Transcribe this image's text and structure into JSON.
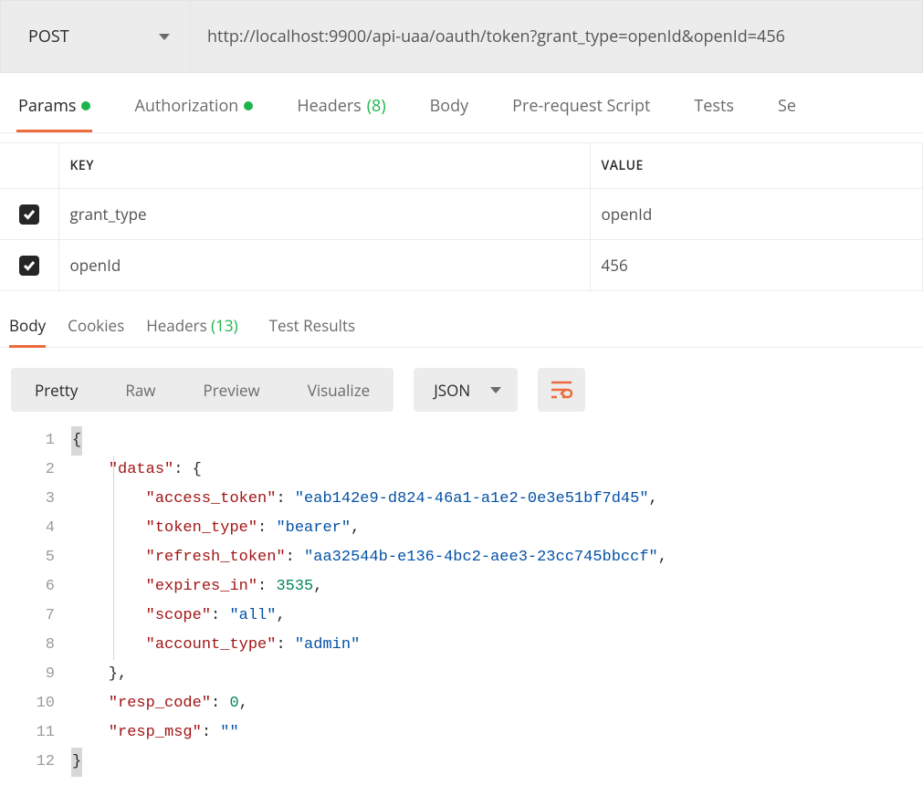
{
  "request": {
    "method": "POST",
    "url": "http://localhost:9900/api-uaa/oauth/token?grant_type=openId&openId=456"
  },
  "requestTabs": {
    "gap1": 50,
    "items": [
      {
        "label": "Params",
        "dot": true,
        "active": true
      },
      {
        "label": "Authorization",
        "dot": true
      },
      {
        "label": "Headers",
        "count": "(8)"
      },
      {
        "label": "Body"
      },
      {
        "label": "Pre-request Script"
      },
      {
        "label": "Tests"
      },
      {
        "label": "Se"
      }
    ]
  },
  "paramsTable": {
    "headers": {
      "key": "KEY",
      "value": "VALUE"
    },
    "rows": [
      {
        "checked": true,
        "key": "grant_type",
        "value": "openId"
      },
      {
        "checked": true,
        "key": "openId",
        "value": "456"
      }
    ]
  },
  "responseTabs": {
    "items": [
      {
        "label": "Body",
        "active": true
      },
      {
        "label": "Cookies"
      },
      {
        "label": "Headers",
        "count": "(13)"
      },
      {
        "label": "Test Results"
      }
    ]
  },
  "viewBar": {
    "modes": [
      "Pretty",
      "Raw",
      "Preview",
      "Visualize"
    ],
    "activeMode": "Pretty",
    "lang": "JSON"
  },
  "body": {
    "datas": {
      "access_token": "eab142e9-d824-46a1-a1e2-0e3e51bf7d45",
      "token_type": "bearer",
      "refresh_token": "aa32544b-e136-4bc2-aee3-23cc745bbccf",
      "expires_in": 3535,
      "scope": "all",
      "account_type": "admin"
    },
    "resp_code": 0,
    "resp_msg": ""
  },
  "codeLineCount": 12
}
